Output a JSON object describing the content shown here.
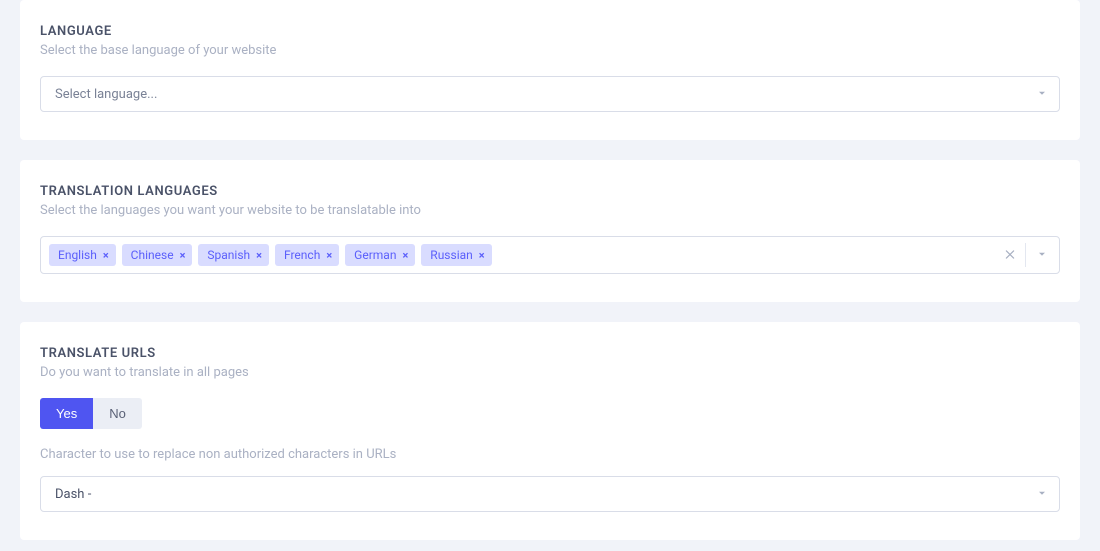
{
  "language": {
    "title": "LANGUAGE",
    "description": "Select the base language of your website",
    "placeholder": "Select language..."
  },
  "translation": {
    "title": "TRANSLATION LANGUAGES",
    "description": "Select the languages you want your website to be translatable into",
    "tags": [
      "English",
      "Chinese",
      "Spanish",
      "French",
      "German",
      "Russian"
    ]
  },
  "urls": {
    "title": "TRANSLATE URLS",
    "description": "Do you want to translate in all pages",
    "yes_label": "Yes",
    "no_label": "No",
    "char_description": "Character to use to replace non authorized characters in URLs",
    "char_value": "Dash -"
  }
}
